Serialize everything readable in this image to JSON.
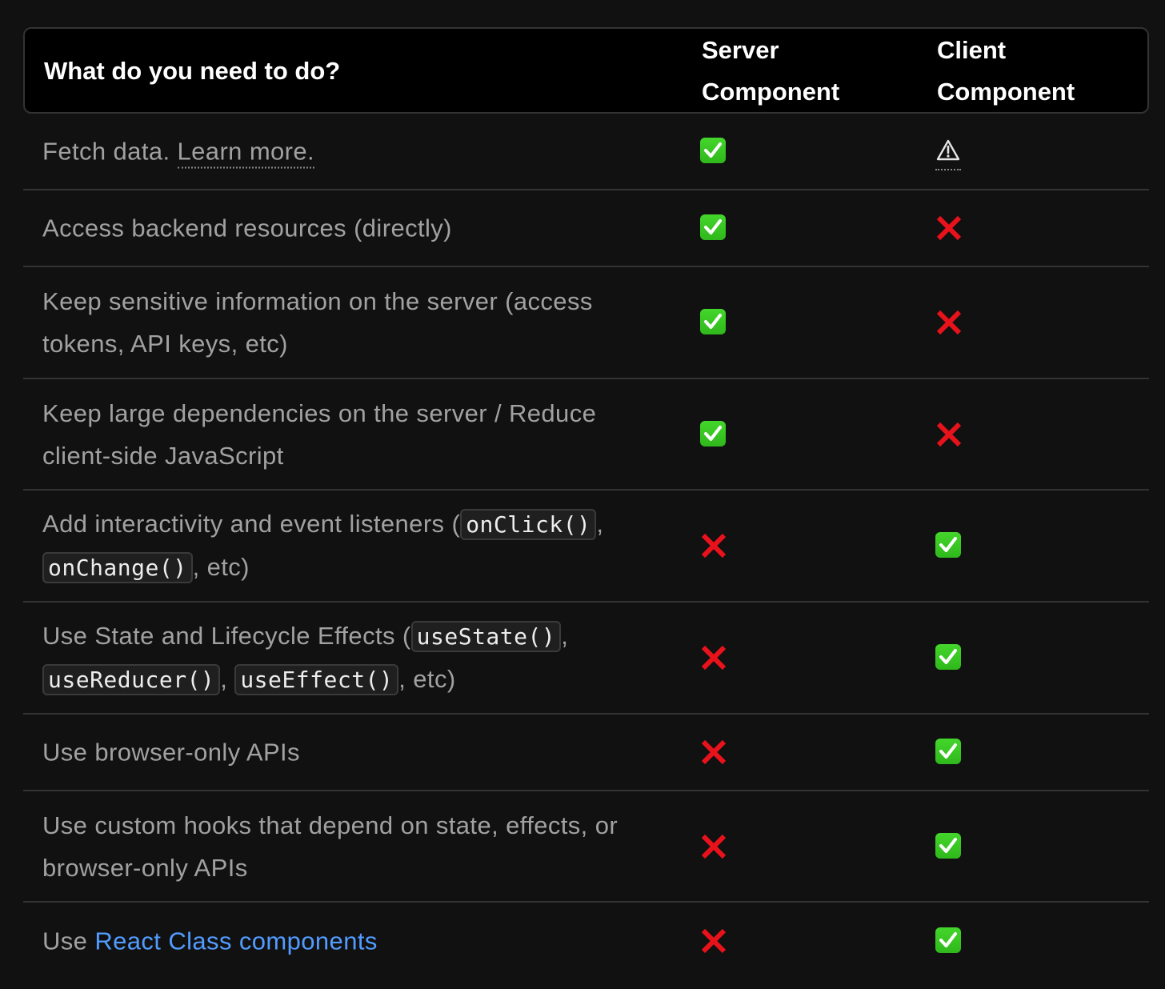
{
  "header": {
    "question": "What do you need to do?",
    "server": [
      "Server",
      "Component"
    ],
    "client": [
      "Client",
      "Component"
    ]
  },
  "rows": [
    {
      "segments": [
        {
          "type": "text",
          "text": "Fetch data. "
        },
        {
          "type": "dotted-link",
          "text": "Learn more."
        }
      ],
      "server": "check",
      "client": "warning",
      "height": 96
    },
    {
      "segments": [
        {
          "type": "text",
          "text": "Access backend resources (directly)"
        }
      ],
      "server": "check",
      "client": "cross",
      "height": 96
    },
    {
      "segments": [
        {
          "type": "text",
          "text": "Keep sensitive information on the server (access tokens, API keys, etc)"
        }
      ],
      "server": "check",
      "client": "cross",
      "height": 140
    },
    {
      "segments": [
        {
          "type": "text",
          "text": "Keep large dependencies on the server / Reduce client-side JavaScript"
        }
      ],
      "server": "check",
      "client": "cross",
      "height": 139
    },
    {
      "segments": [
        {
          "type": "text",
          "text": "Add interactivity and event listeners ("
        },
        {
          "type": "code",
          "text": "onClick()"
        },
        {
          "type": "text",
          "text": ", "
        },
        {
          "type": "code",
          "text": "onChange()"
        },
        {
          "type": "text",
          "text": ", etc)"
        }
      ],
      "server": "cross",
      "client": "check",
      "height": 140
    },
    {
      "segments": [
        {
          "type": "text",
          "text": "Use State and Lifecycle Effects ("
        },
        {
          "type": "code",
          "text": "useState()"
        },
        {
          "type": "text",
          "text": ", "
        },
        {
          "type": "code",
          "text": "useReducer()"
        },
        {
          "type": "text",
          "text": ", "
        },
        {
          "type": "code",
          "text": "useEffect()"
        },
        {
          "type": "text",
          "text": ", etc)"
        }
      ],
      "server": "cross",
      "client": "check",
      "height": 140
    },
    {
      "segments": [
        {
          "type": "text",
          "text": "Use browser-only APIs"
        }
      ],
      "server": "cross",
      "client": "check",
      "height": 96
    },
    {
      "segments": [
        {
          "type": "text",
          "text": "Use custom hooks that depend on state, effects, or browser-only APIs"
        }
      ],
      "server": "cross",
      "client": "check",
      "height": 139
    },
    {
      "segments": [
        {
          "type": "text",
          "text": "Use "
        },
        {
          "type": "link",
          "text": "React Class components"
        }
      ],
      "server": "cross",
      "client": "check",
      "height": 96
    }
  ]
}
